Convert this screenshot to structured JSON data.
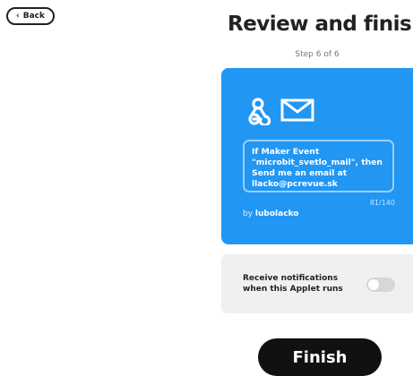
{
  "nav": {
    "back_label": "Back",
    "back_icon": "chevron-left-icon"
  },
  "header": {
    "title": "Review and finish",
    "step": "Step 6 of 6"
  },
  "applet": {
    "card_color": "#2196f3",
    "trigger_icon": "webhook-icon",
    "action_icon": "mail-icon",
    "description": "If Maker Event \"microbit_svetlo_mail\", then Send me an email at llacko@pcrevue.sk",
    "char_count": "81/140",
    "by_prefix": "by",
    "author": "lubolacko"
  },
  "notifications": {
    "label_line1": "Receive notifications",
    "label_line2": "when this Applet runs",
    "enabled": false
  },
  "finish_label": "Finish"
}
